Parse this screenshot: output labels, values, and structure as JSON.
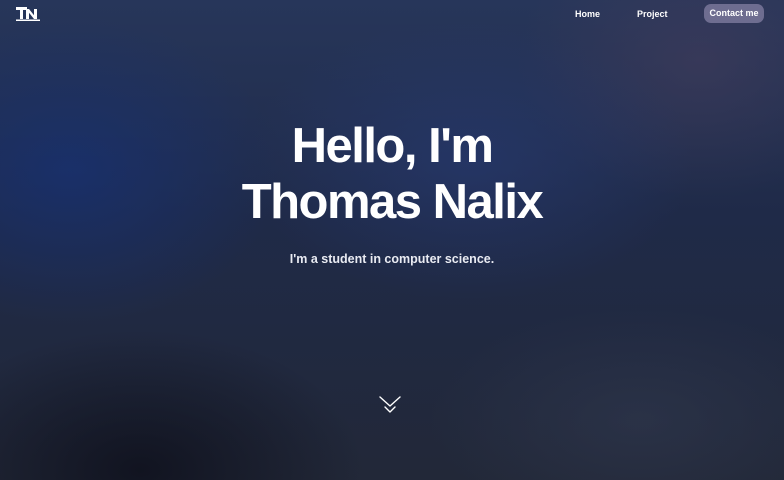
{
  "nav": {
    "logo_text": "TN",
    "logo_icon": "tn-monogram-logo",
    "links": [
      {
        "label": "Home"
      },
      {
        "label": "Project"
      }
    ],
    "contact_label": "Contact me"
  },
  "hero": {
    "title_line1": "Hello, I'm",
    "title_line2": "Thomas Nalix",
    "subtitle": "I'm a student in computer science.",
    "scroll_icon": "chevron-double-down-icon"
  },
  "colors": {
    "background_dark_navy": "#1e2640",
    "contact_button": "#6e6d90",
    "text": "#ffffff"
  }
}
